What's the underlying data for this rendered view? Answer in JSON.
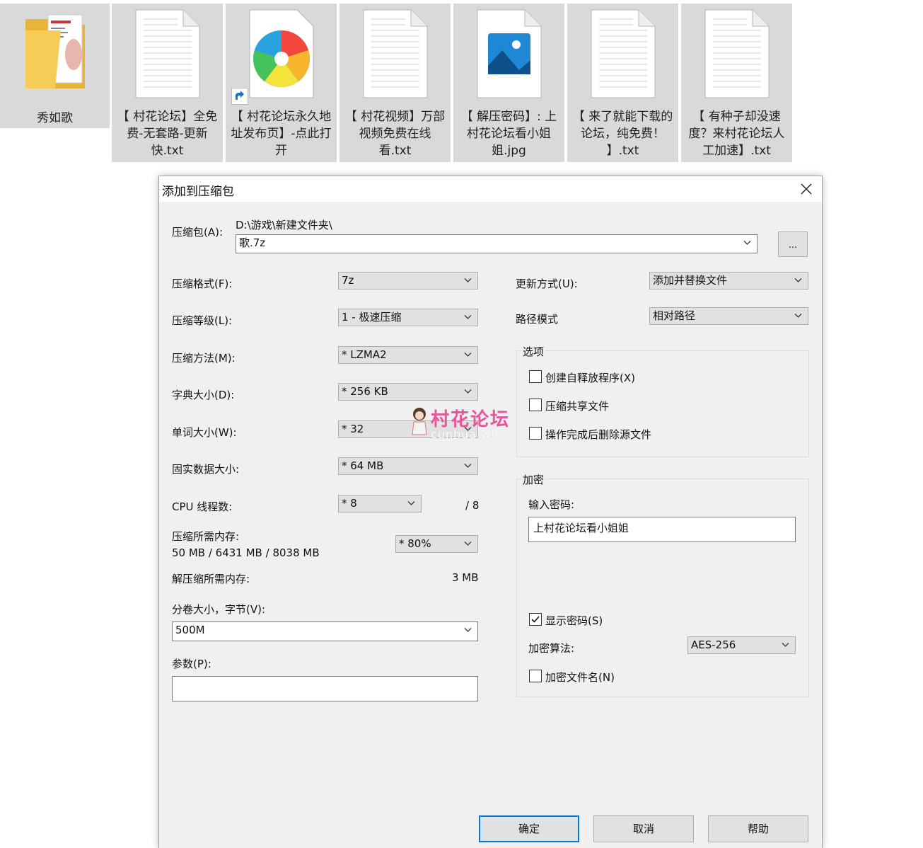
{
  "files": [
    {
      "label": "秀如歌"
    },
    {
      "label": "【 村花论坛】全免费-无套路-更新快.txt"
    },
    {
      "label": "【 村花论坛永久地址发布页】-点此打开"
    },
    {
      "label": "【 村花视频】万部视频免费在线看.txt"
    },
    {
      "label": "【 解压密码】: 上村花论坛看小姐姐.jpg"
    },
    {
      "label": "【 来了就能下载的论坛，纯免费！ 】.txt"
    },
    {
      "label": "【 有种子却没速度？来村花论坛人工加速】.txt"
    }
  ],
  "dialog": {
    "title": "添加到压缩包",
    "archive_label": "压缩包(A):",
    "archive_path": "D:\\游戏\\新建文件夹\\",
    "archive_name": "歌.7z",
    "browse_label": "...",
    "format_label": "压缩格式(F):",
    "format_value": "7z",
    "level_label": "压缩等级(L):",
    "level_value": "1 - 极速压缩",
    "method_label": "压缩方法(M):",
    "method_value": "*  LZMA2",
    "dict_label": "字典大小(D):",
    "dict_value": "*  256 KB",
    "word_label": "单词大小(W):",
    "word_value": "*  32",
    "solid_label": "固实数据大小:",
    "solid_value": "*  64 MB",
    "cpu_label": "CPU 线程数:",
    "cpu_value": "*  8",
    "cpu_total": "/ 8",
    "mem_label": "压缩所需内存:",
    "mem_value": "50 MB / 6431 MB / 8038 MB",
    "mem_percent": "* 80%",
    "decomp_label": "解压缩所需内存:",
    "decomp_value": "3 MB",
    "split_label": "分卷大小，字节(V):",
    "split_value": "500M",
    "params_label": "参数(P):",
    "params_value": "",
    "update_label": "更新方式(U):",
    "update_value": "添加并替换文件",
    "path_label": "路径模式",
    "path_value": "相对路径",
    "options_title": "选项",
    "opt_sfx": "创建自释放程序(X)",
    "opt_shared": "压缩共享文件",
    "opt_delete": "操作完成后删除源文件",
    "enc_title": "加密",
    "pwd_label": "输入密码:",
    "pwd_value": "上村花论坛看小姐姐",
    "show_pwd": "显示密码(S)",
    "algo_label": "加密算法:",
    "algo_value": "AES-256",
    "enc_names": "加密文件名(N)",
    "ok": "确定",
    "cancel": "取消",
    "help": "帮助"
  },
  "watermark": {
    "text": "村花论坛",
    "sub": "cunhua.win"
  },
  "colors": {
    "tile_bg": "#d9d9d9",
    "dialog_bg": "#f0f0f0",
    "default_border": "#0078d7",
    "watermark": "#e8559a"
  }
}
